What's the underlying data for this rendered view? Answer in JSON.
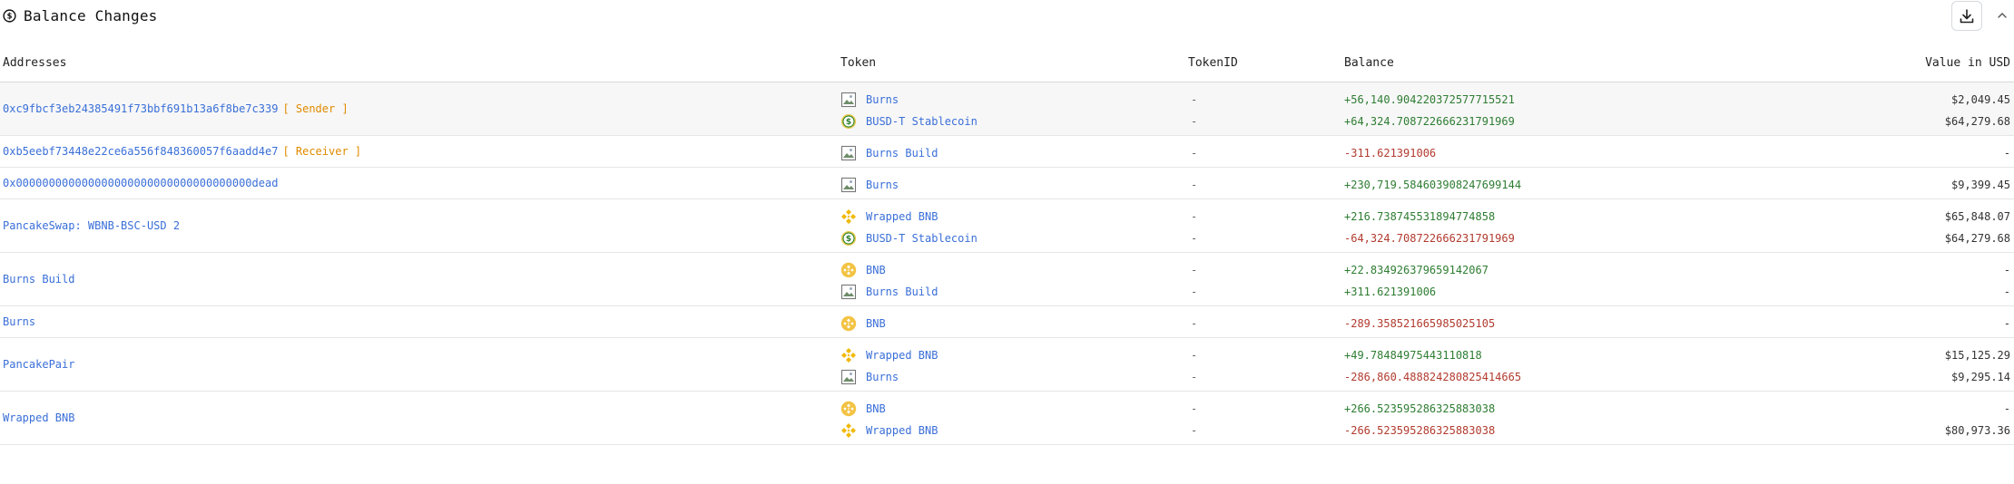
{
  "header": {
    "title": "Balance Changes"
  },
  "columns": {
    "addresses": "Addresses",
    "token": "Token",
    "token_id": "TokenID",
    "balance": "Balance",
    "value_usd": "Value in USD"
  },
  "colors": {
    "link": "#3a6fd8",
    "tag": "#e08a00",
    "positive": "#2e7d32",
    "negative": "#b23b2f"
  },
  "rows": [
    {
      "address": "0xc9fbcf3eb24385491f73bbf691b13a6f8be7c339",
      "tag": "[ Sender ]",
      "tokens": [
        {
          "icon": "image-placeholder-icon",
          "name": "Burns",
          "token_id": "-",
          "balance": "+56,140.904220372577715521",
          "sign": "pos",
          "usd": "$2,049.45"
        },
        {
          "icon": "busd-icon",
          "name": "BUSD-T Stablecoin",
          "token_id": "-",
          "balance": "+64,324.708722666231791969",
          "sign": "pos",
          "usd": "$64,279.68"
        }
      ]
    },
    {
      "address": "0xb5eebf73448e22ce6a556f848360057f6aadd4e7",
      "tag": "[ Receiver ]",
      "tokens": [
        {
          "icon": "image-placeholder-icon",
          "name": "Burns Build",
          "token_id": "-",
          "balance": "-311.621391006",
          "sign": "neg",
          "usd": "-"
        }
      ]
    },
    {
      "address": "0x000000000000000000000000000000000000dead",
      "tag": "",
      "tokens": [
        {
          "icon": "image-placeholder-icon",
          "name": "Burns",
          "token_id": "-",
          "balance": "+230,719.584603908247699144",
          "sign": "pos",
          "usd": "$9,399.45"
        }
      ]
    },
    {
      "address": "PancakeSwap: WBNB-BSC-USD 2",
      "tag": "",
      "tokens": [
        {
          "icon": "bnb-icon",
          "name": "Wrapped BNB",
          "token_id": "-",
          "balance": "+216.738745531894774858",
          "sign": "pos",
          "usd": "$65,848.07"
        },
        {
          "icon": "busd-icon",
          "name": "BUSD-T Stablecoin",
          "token_id": "-",
          "balance": "-64,324.708722666231791969",
          "sign": "neg",
          "usd": "$64,279.68"
        }
      ]
    },
    {
      "address": "Burns Build",
      "tag": "",
      "tokens": [
        {
          "icon": "bnb-coin-icon",
          "name": "BNB",
          "token_id": "-",
          "balance": "+22.834926379659142067",
          "sign": "pos",
          "usd": "-"
        },
        {
          "icon": "image-placeholder-icon",
          "name": "Burns Build",
          "token_id": "-",
          "balance": "+311.621391006",
          "sign": "pos",
          "usd": "-"
        }
      ]
    },
    {
      "address": "Burns",
      "tag": "",
      "tokens": [
        {
          "icon": "bnb-coin-icon",
          "name": "BNB",
          "token_id": "-",
          "balance": "-289.358521665985025105",
          "sign": "neg",
          "usd": "-"
        }
      ]
    },
    {
      "address": "PancakePair",
      "tag": "",
      "tokens": [
        {
          "icon": "bnb-icon",
          "name": "Wrapped BNB",
          "token_id": "-",
          "balance": "+49.78484975443110818",
          "sign": "pos",
          "usd": "$15,125.29"
        },
        {
          "icon": "image-placeholder-icon",
          "name": "Burns",
          "token_id": "-",
          "balance": "-286,860.488824280825414665",
          "sign": "neg",
          "usd": "$9,295.14"
        }
      ]
    },
    {
      "address": "Wrapped BNB",
      "tag": "",
      "tokens": [
        {
          "icon": "bnb-coin-icon",
          "name": "BNB",
          "token_id": "-",
          "balance": "+266.523595286325883038",
          "sign": "pos",
          "usd": "-"
        },
        {
          "icon": "bnb-icon",
          "name": "Wrapped BNB",
          "token_id": "-",
          "balance": "-266.523595286325883038",
          "sign": "neg",
          "usd": "$80,973.36"
        }
      ]
    }
  ]
}
